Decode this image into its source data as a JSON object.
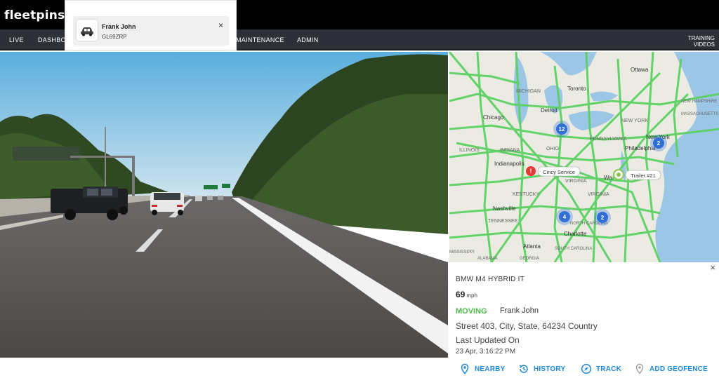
{
  "brand": {
    "logo_text": "fleetpins"
  },
  "nav": {
    "items": [
      "LIVE",
      "DASHBOA",
      "MAINTENANCE",
      "ADMIN"
    ],
    "training_line1": "TRAINING",
    "training_line2": "VIDEOS"
  },
  "driver_popup": {
    "name": "Frank John",
    "plate": "GL69ZRP",
    "close_icon": "×"
  },
  "map": {
    "cities": [
      "Ottawa",
      "MICHIGAN",
      "Toronto",
      "Detroit",
      "Chicago",
      "NEW YORK",
      "NEW HAMPSHIRE",
      "MASSACHUSETTS",
      "PENNSYLVANIA",
      "New York",
      "ILLINOIS",
      "INDIANA",
      "OHIO",
      "Philadelphia",
      "Indianapolis",
      "Wa.",
      "VIRGINIA",
      "KENTUCKY",
      "Nashville",
      "VIRGINIA",
      "TENNESSEE",
      "Charlotte",
      "NORTH CAROLINA",
      "SOUTH CAROLINA",
      "Atlanta",
      "MISSISSIPPI",
      "ALABAMA",
      "GEORGIA"
    ],
    "clusters": [
      "12",
      "2",
      "4",
      "2"
    ],
    "labels": {
      "cincy": "Cincy Service",
      "trailer": "Trailer #21"
    }
  },
  "info": {
    "vehicle": "BMW M4 HYBRID IT",
    "speed": "69",
    "speed_unit": "mph",
    "status": "MOVING",
    "driver": "Frank John",
    "address": "Street 403, City, State, 64234 Country",
    "last_updated_label": "Last Updated On",
    "timestamp": "23 Apr, 3:16:22 PM",
    "close_icon": "×"
  },
  "actions": [
    "NEARBY",
    "HISTORY",
    "TRACK",
    "ADD GEOFENCE"
  ],
  "colors": {
    "accent": "#1e88d9",
    "moving": "#4cbb4c",
    "navbar": "#2d3038",
    "road": "#5bd163"
  }
}
